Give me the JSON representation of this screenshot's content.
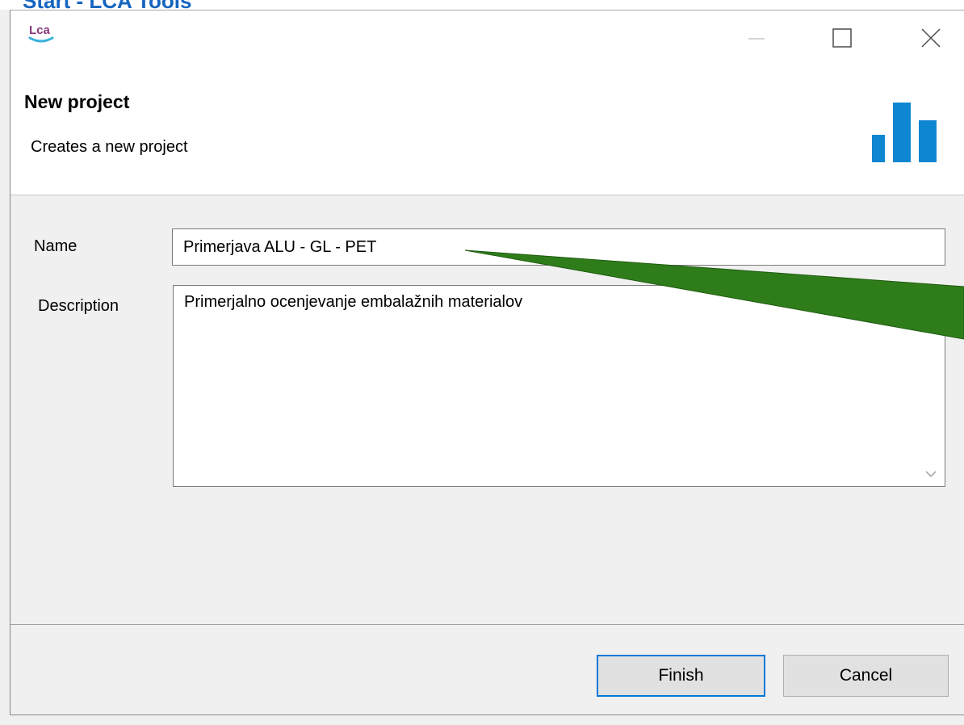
{
  "background_window": {
    "title_fragment": "Start - LCA Tools"
  },
  "dialog": {
    "logo_icon": "openlca-logo-icon",
    "window_controls": {
      "minimize_icon": "minimize-icon",
      "maximize_icon": "maximize-icon",
      "close_icon": "close-icon"
    },
    "banner": {
      "title": "New project",
      "subtitle": "Creates a new project",
      "icon": "bar-chart-icon",
      "icon_color": "#0f86d2"
    },
    "form": {
      "name_label": "Name",
      "name_value": "Primerjava ALU - GL - PET",
      "description_label": "Description",
      "description_value": "Primerjalno ocenjevanje embalažnih materialov"
    },
    "buttons": {
      "finish": "Finish",
      "cancel": "Cancel"
    },
    "accent_color": "#0078d7"
  },
  "annotation": {
    "type": "arrow",
    "color": "#2e7d1a"
  }
}
